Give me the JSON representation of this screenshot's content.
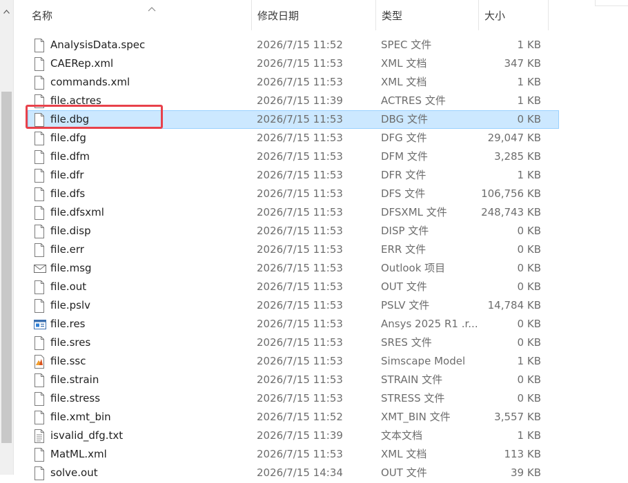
{
  "columns": {
    "name": "名称",
    "date": "修改日期",
    "type": "类型",
    "size": "大小"
  },
  "files": [
    {
      "name": "AnalysisData.spec",
      "date": "2026/7/15 11:52",
      "type": "SPEC 文件",
      "size": "1 KB",
      "icon": "file-icon"
    },
    {
      "name": "CAERep.xml",
      "date": "2026/7/15 11:53",
      "type": "XML 文档",
      "size": "347 KB",
      "icon": "file-icon"
    },
    {
      "name": "commands.xml",
      "date": "2026/7/15 11:53",
      "type": "XML 文档",
      "size": "1 KB",
      "icon": "file-icon"
    },
    {
      "name": "file.actres",
      "date": "2026/7/15 11:39",
      "type": "ACTRES 文件",
      "size": "1 KB",
      "icon": "file-icon"
    },
    {
      "name": "file.dbg",
      "date": "2026/7/15 11:53",
      "type": "DBG 文件",
      "size": "0 KB",
      "icon": "file-icon",
      "selected": true
    },
    {
      "name": "file.dfg",
      "date": "2026/7/15 11:53",
      "type": "DFG 文件",
      "size": "29,047 KB",
      "icon": "file-icon"
    },
    {
      "name": "file.dfm",
      "date": "2026/7/15 11:53",
      "type": "DFM 文件",
      "size": "3,285 KB",
      "icon": "file-icon"
    },
    {
      "name": "file.dfr",
      "date": "2026/7/15 11:53",
      "type": "DFR 文件",
      "size": "1 KB",
      "icon": "file-icon"
    },
    {
      "name": "file.dfs",
      "date": "2026/7/15 11:53",
      "type": "DFS 文件",
      "size": "106,756 KB",
      "icon": "file-icon"
    },
    {
      "name": "file.dfsxml",
      "date": "2026/7/15 11:53",
      "type": "DFSXML 文件",
      "size": "248,743 KB",
      "icon": "file-icon"
    },
    {
      "name": "file.disp",
      "date": "2026/7/15 11:53",
      "type": "DISP 文件",
      "size": "0 KB",
      "icon": "file-icon"
    },
    {
      "name": "file.err",
      "date": "2026/7/15 11:53",
      "type": "ERR 文件",
      "size": "0 KB",
      "icon": "file-icon"
    },
    {
      "name": "file.msg",
      "date": "2026/7/15 11:53",
      "type": "Outlook 项目",
      "size": "0 KB",
      "icon": "envelope-icon"
    },
    {
      "name": "file.out",
      "date": "2026/7/15 11:53",
      "type": "OUT 文件",
      "size": "0 KB",
      "icon": "file-icon"
    },
    {
      "name": "file.pslv",
      "date": "2026/7/15 11:53",
      "type": "PSLV 文件",
      "size": "14,784 KB",
      "icon": "file-icon"
    },
    {
      "name": "file.res",
      "date": "2026/7/15 11:53",
      "type": "Ansys 2025 R1 .r...",
      "size": "0 KB",
      "icon": "ansys-result-icon"
    },
    {
      "name": "file.sres",
      "date": "2026/7/15 11:53",
      "type": "SRES 文件",
      "size": "0 KB",
      "icon": "file-icon"
    },
    {
      "name": "file.ssc",
      "date": "2026/7/15 11:53",
      "type": "Simscape Model",
      "size": "1 KB",
      "icon": "matlab-icon"
    },
    {
      "name": "file.strain",
      "date": "2026/7/15 11:53",
      "type": "STRAIN 文件",
      "size": "0 KB",
      "icon": "file-icon"
    },
    {
      "name": "file.stress",
      "date": "2026/7/15 11:53",
      "type": "STRESS 文件",
      "size": "0 KB",
      "icon": "file-icon"
    },
    {
      "name": "file.xmt_bin",
      "date": "2026/7/15 11:52",
      "type": "XMT_BIN 文件",
      "size": "3,557 KB",
      "icon": "file-icon"
    },
    {
      "name": "isvalid_dfg.txt",
      "date": "2026/7/15 11:39",
      "type": "文本文档",
      "size": "1 KB",
      "icon": "text-file-icon"
    },
    {
      "name": "MatML.xml",
      "date": "2026/7/15 11:53",
      "type": "XML 文档",
      "size": "113 KB",
      "icon": "file-icon"
    },
    {
      "name": "solve.out",
      "date": "2026/7/15 14:34",
      "type": "OUT 文件",
      "size": "39 KB",
      "icon": "file-icon"
    }
  ],
  "colors": {
    "selected_bg": "#cce8ff",
    "selected_border": "#99d1ff",
    "annotation": "#e8414b"
  }
}
